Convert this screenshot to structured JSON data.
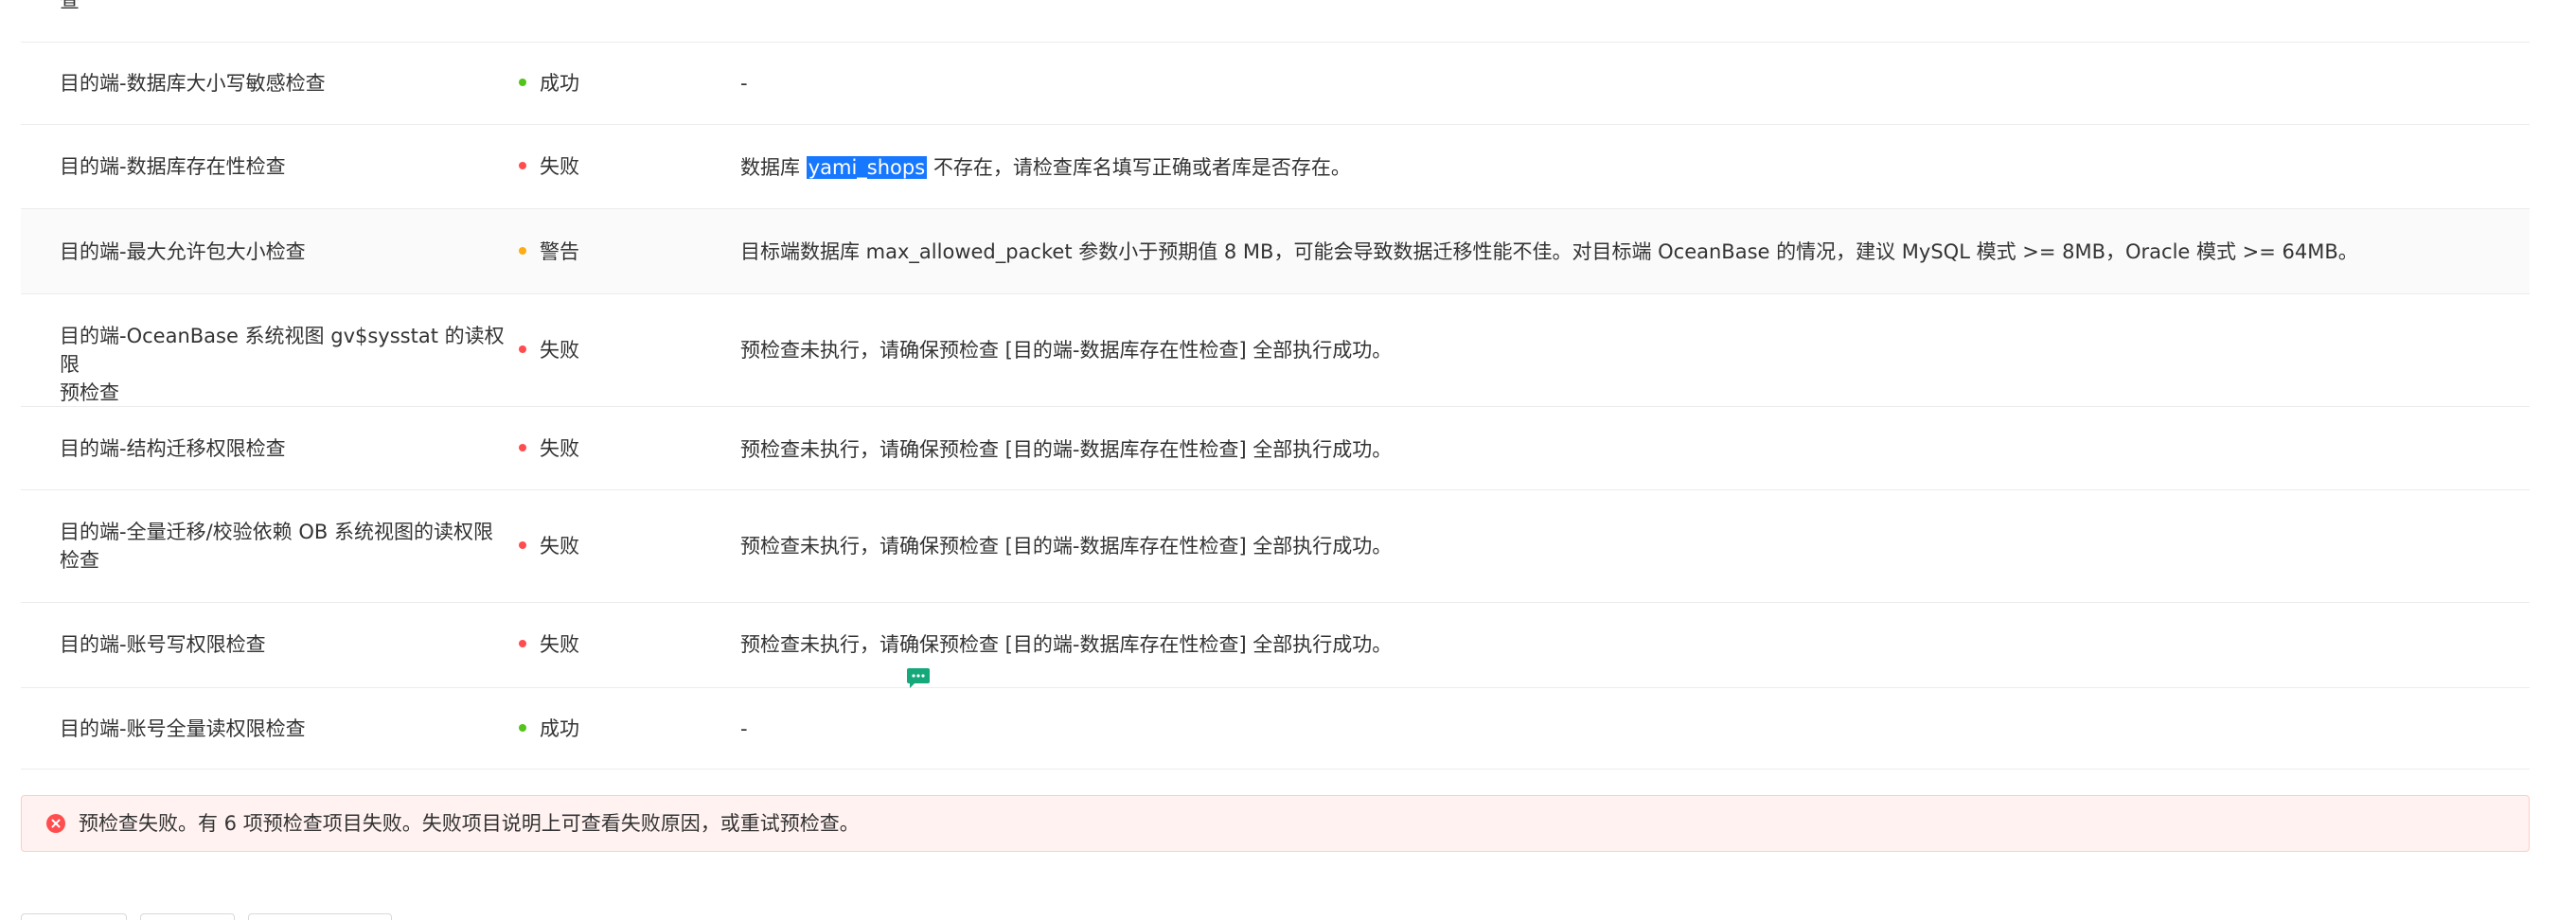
{
  "table": {
    "partial_top_text": "查",
    "rows": [
      {
        "name": "目的端-数据库大小写敏感检查",
        "status": "成功",
        "status_color": "#52c41a",
        "desc_pre": "-",
        "desc_hl": "",
        "desc_post": ""
      },
      {
        "name": "目的端-数据库存在性检查",
        "status": "失败",
        "status_color": "#ff4d4f",
        "desc_pre": "数据库 ",
        "desc_hl": "yami_shops",
        "desc_post": " 不存在，请检查库名填写正确或者库是否存在。"
      },
      {
        "name": "目的端-最大允许包大小检查",
        "status": "警告",
        "status_color": "#faad14",
        "desc_pre": "目标端数据库 max_allowed_packet 参数小于预期值 8 MB，可能会导致数据迁移性能不佳。对目标端 OceanBase 的情况，建议 MySQL 模式 >= 8MB，Oracle 模式 >= 64MB。",
        "desc_hl": "",
        "desc_post": ""
      },
      {
        "name_line1": "目的端-OceanBase 系统视图 gv$sysstat 的读权限",
        "name_line2": "预检查",
        "status": "失败",
        "status_color": "#ff4d4f",
        "desc_pre": "预检查未执行，请确保预检查 [目的端-数据库存在性检查] 全部执行成功。",
        "desc_hl": "",
        "desc_post": ""
      },
      {
        "name": "目的端-结构迁移权限检查",
        "status": "失败",
        "status_color": "#ff4d4f",
        "desc_pre": "预检查未执行，请确保预检查 [目的端-数据库存在性检查] 全部执行成功。",
        "desc_hl": "",
        "desc_post": ""
      },
      {
        "name_line1": "目的端-全量迁移/校验依赖 OB 系统视图的读权限",
        "name_line2": "检查",
        "status": "失败",
        "status_color": "#ff4d4f",
        "desc_pre": "预检查未执行，请确保预检查 [目的端-数据库存在性检查] 全部执行成功。",
        "desc_hl": "",
        "desc_post": ""
      },
      {
        "name": "目的端-账号写权限检查",
        "status": "失败",
        "status_color": "#ff4d4f",
        "desc_pre": "预检查未执行，请确保预检查 [目的端-数据库存在性检查] 全部执行成功。",
        "desc_hl": "",
        "desc_post": ""
      },
      {
        "name": "目的端-账号全量读权限检查",
        "status": "成功",
        "status_color": "#52c41a",
        "desc_pre": "-",
        "desc_hl": "",
        "desc_post": ""
      }
    ]
  },
  "alert": {
    "icon": "close-circle-icon",
    "text": "预检查失败。有 6 项预检查项目失败。失败项目说明上可查看失败原因，或重试预检查。",
    "color": "#ff4d4f"
  },
  "floating": {
    "icon": "chat-bubble-icon",
    "color": "#15a87a"
  }
}
